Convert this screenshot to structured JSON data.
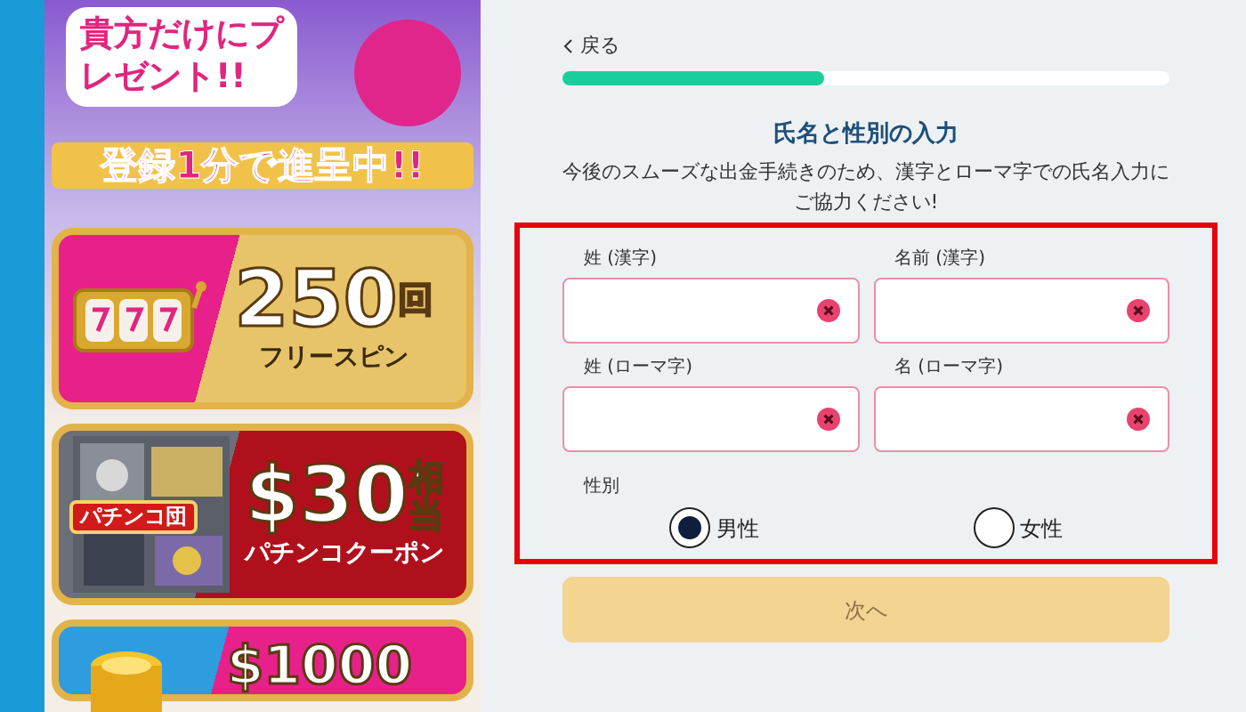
{
  "promo": {
    "headline": "貴方だけにプレゼント!!",
    "ribbon": "登録1分で進呈中!!",
    "cards": [
      {
        "kind": "slot",
        "amount": "250",
        "unit": "回",
        "caption": "フリースピン"
      },
      {
        "kind": "pachinko",
        "amount": "$30",
        "unit": "相当",
        "caption": "パチンコクーポン",
        "badge": "パチンコ団"
      },
      {
        "kind": "coins",
        "amount": "$1000"
      }
    ]
  },
  "form": {
    "back": "戻る",
    "progress": {
      "level": 0.43
    },
    "title": "氏名と性別の入力",
    "description": "今後のスムーズな出金手続きのため、漢字とローマ字での氏名入力にご協力ください!",
    "fields": [
      {
        "label": "姓 (漢字)",
        "invalid": true
      },
      {
        "label": "名前 (漢字)",
        "invalid": true
      },
      {
        "label": "姓 (ローマ字)",
        "invalid": true
      },
      {
        "label": "名 (ローマ字)",
        "invalid": true
      }
    ],
    "gender": {
      "label": "性別",
      "options": [
        {
          "label": "男性",
          "selected": true
        },
        {
          "label": "女性",
          "selected": false
        }
      ]
    },
    "next": {
      "label": "次へ",
      "disabled": true
    }
  }
}
